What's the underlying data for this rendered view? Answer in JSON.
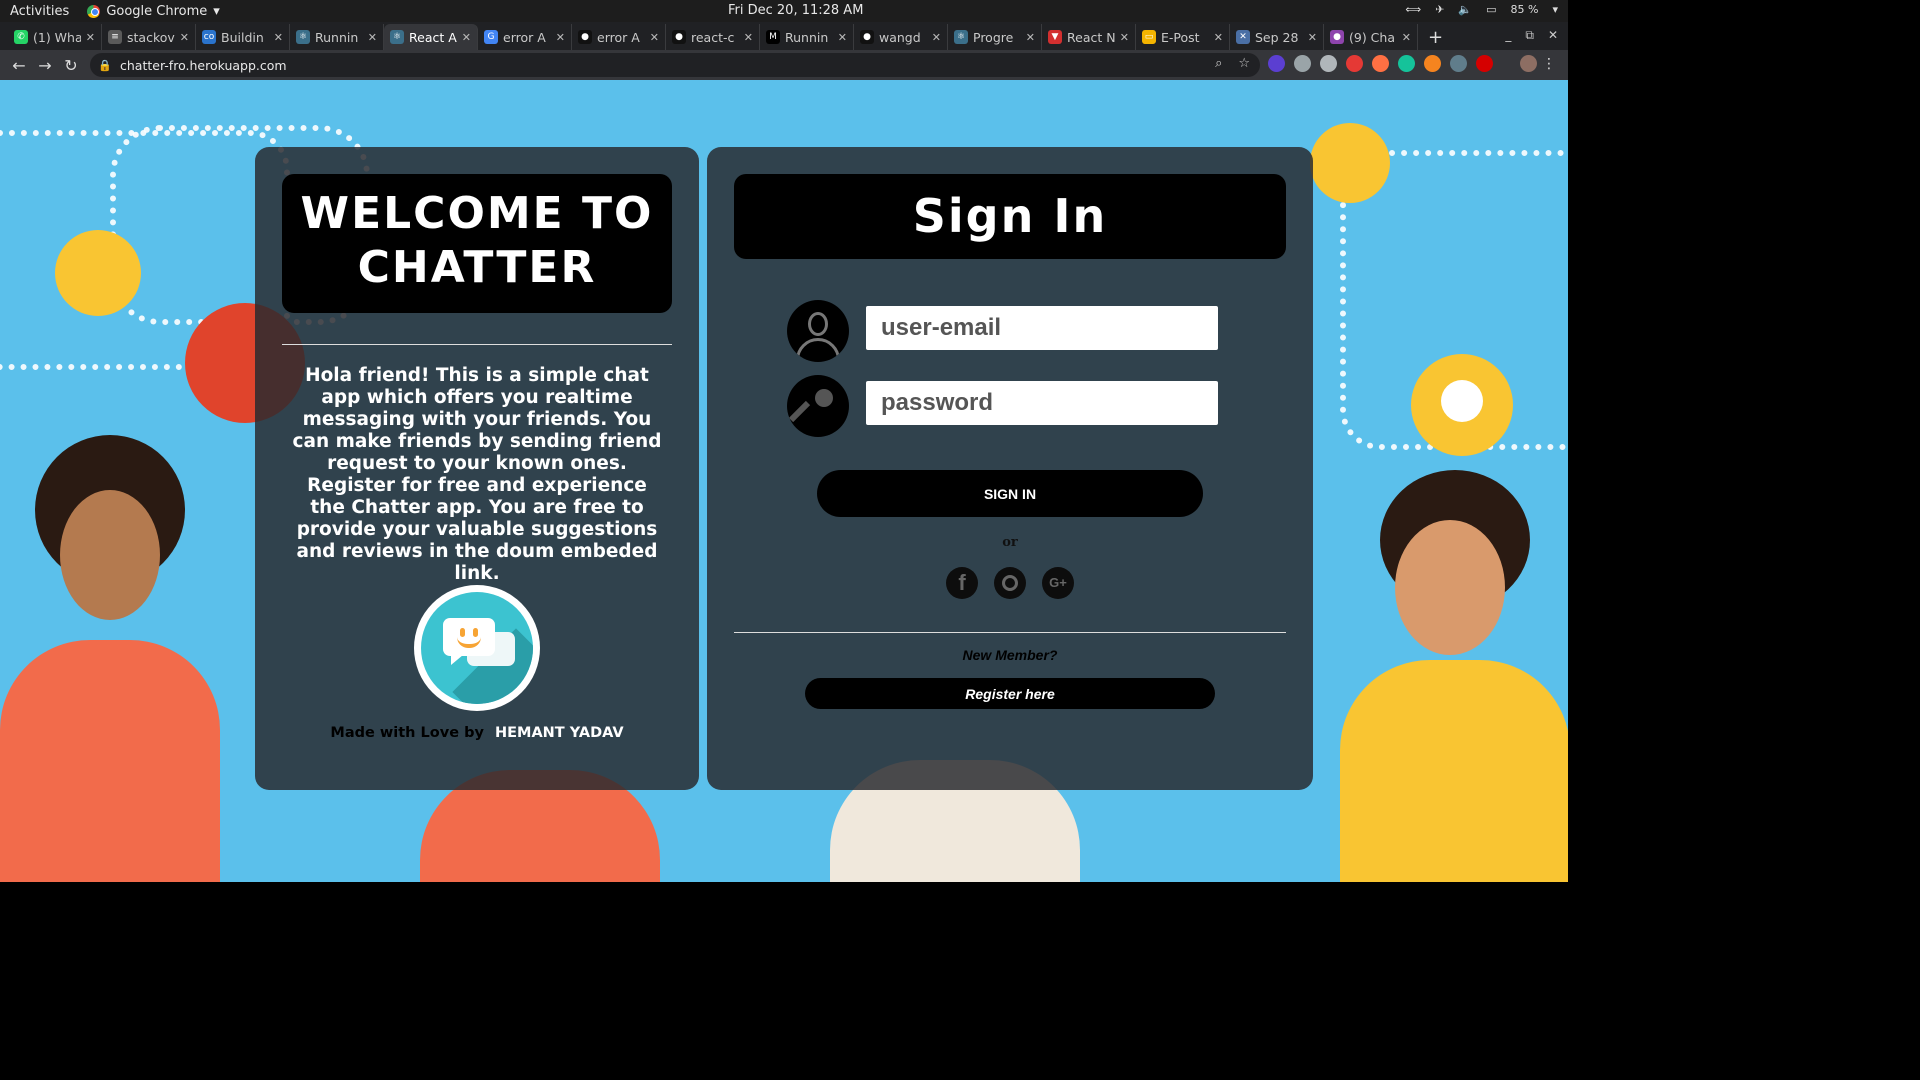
{
  "system_bar": {
    "activities": "Activities",
    "app_name": "Google Chrome",
    "clock": "Fri Dec 20, 11:28 AM",
    "battery": "85 %"
  },
  "tabs": [
    {
      "title": "(1) Wha",
      "icon": "whatsapp-icon",
      "color": "#25d366",
      "glyph": "✆"
    },
    {
      "title": "stackov",
      "icon": "stackoverflow-icon",
      "color": "#5a5a5a",
      "glyph": "≡"
    },
    {
      "title": "Buildin",
      "icon": "coursera-icon",
      "color": "#2a73cc",
      "glyph": "co"
    },
    {
      "title": "Runnin",
      "icon": "react-icon",
      "color": "#3b6f8a",
      "glyph": "⚛"
    },
    {
      "title": "React A",
      "icon": "react-icon",
      "color": "#3b6f8a",
      "glyph": "⚛"
    },
    {
      "title": "error A",
      "icon": "google-icon",
      "color": "#4285f4",
      "glyph": "G"
    },
    {
      "title": "error A",
      "icon": "github-icon",
      "color": "#111111",
      "glyph": "●"
    },
    {
      "title": "react-c",
      "icon": "github-icon",
      "color": "#111111",
      "glyph": "●"
    },
    {
      "title": "Runnin",
      "icon": "medium-icon",
      "color": "#000000",
      "glyph": "M"
    },
    {
      "title": "wangd",
      "icon": "github-icon",
      "color": "#111111",
      "glyph": "●"
    },
    {
      "title": "Progre",
      "icon": "react-icon",
      "color": "#3b6f8a",
      "glyph": "⚛"
    },
    {
      "title": "React N",
      "icon": "vercel-icon",
      "color": "#d32f2f",
      "glyph": "▼"
    },
    {
      "title": "E-Post",
      "icon": "slides-icon",
      "color": "#f4b400",
      "glyph": "▭"
    },
    {
      "title": "Sep 28",
      "icon": "calendar-icon",
      "color": "#4a6fa5",
      "glyph": "✕"
    },
    {
      "title": "(9) Cha",
      "icon": "chat-icon",
      "color": "#8e44ad",
      "glyph": "●"
    }
  ],
  "active_tab_index": 4,
  "address_bar": {
    "url": "chatter-fro.herokuapp.com"
  },
  "welcome": {
    "title": "WELCOME TO CHATTER",
    "description": "Hola friend! This is a simple chat app which offers you realtime messaging with your friends. You can make friends by sending friend request to your known ones. Register for free and experience the Chatter app. You are free to provide your valuable suggestions and reviews in the doum embeded link.",
    "made_with": "Made with Love by",
    "author": "HEMANT YADAV"
  },
  "signin": {
    "title": "Sign In",
    "email_placeholder": "user-email",
    "password_placeholder": "password",
    "button": "SIGN IN",
    "or": "or",
    "social": [
      "facebook",
      "instagram",
      "google-plus"
    ],
    "new_member": "New Member?",
    "register": "Register here"
  },
  "colors": {
    "page_background": "#5bc0eb",
    "panel": "#282a2e",
    "button": "#000000",
    "logo": "#3cc3d0",
    "accent_orange": "#f7a434"
  }
}
